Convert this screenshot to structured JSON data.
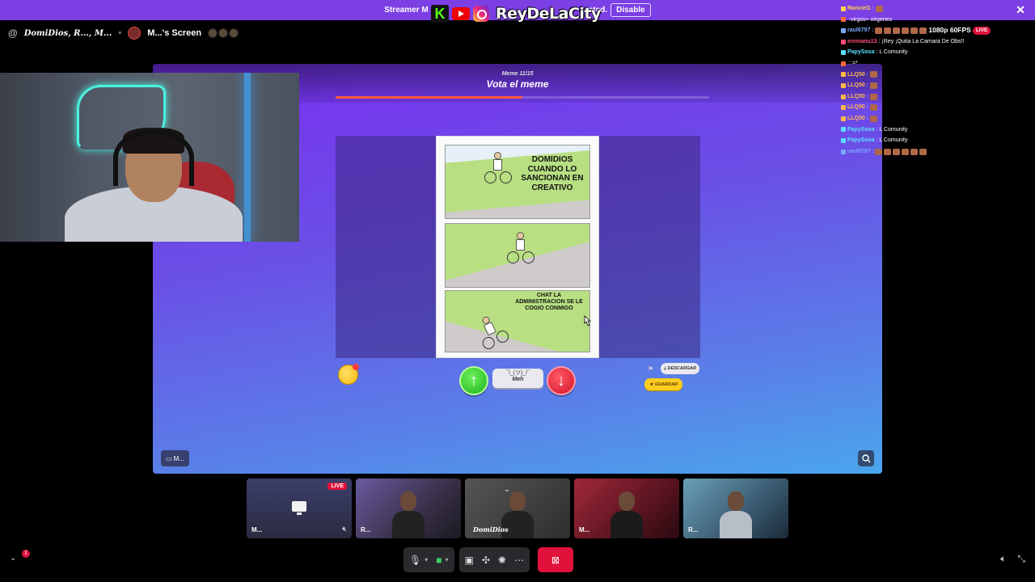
{
  "banner": {
    "text": "Streamer M",
    "text_suffix": "cted.",
    "disable_label": "Disable",
    "close_icon": "close-icon"
  },
  "overlay": {
    "streamer_name": "ReyDeLaCity",
    "icons": [
      "kick-logo",
      "youtube-logo",
      "instagram-logo"
    ]
  },
  "call": {
    "title": "DomiDios, R..., M...",
    "screen_share_label": "M...'s Screen"
  },
  "game": {
    "round_label": "Meme 11/15",
    "heading": "Vota el meme",
    "progress": 0.5,
    "meme": {
      "caption_top": "DOMIDIOS CUANDO LO SANCIONAN EN CREATIVO",
      "caption_bottom": "CHAT LA ADMINISTRACION SE LE COGIO CONMIGO"
    },
    "vote_meh_face": "¯\\_(ツ)_/¯",
    "vote_meh_label": "Meh",
    "download_label": "DESCARGAR",
    "save_label": "GUARDAR",
    "share_badge": "M..."
  },
  "chat": [
    {
      "user": "Ranciel1",
      "text": ":",
      "color": "#ffd24a",
      "emotes": 1
    },
    {
      "user": "",
      "text": ":virgos+ virgenes",
      "color": "#ff6a3c",
      "emotes": 0
    },
    {
      "user": "raul6797",
      "text": ":",
      "color": "#7aa8ff",
      "emotes": 6,
      "fps": "1080p 60FPS",
      "live": "LIVE"
    },
    {
      "user": "emmanu13",
      "text": ": ¡Rey ¡Quita La Camara De Obs!!",
      "color": "#ff4a7a",
      "emotes": 0
    },
    {
      "user": "PapySosa",
      "text": ": L Comunity",
      "color": "#5ae0ff",
      "emotes": 0
    },
    {
      "user": "",
      "text": ": =*",
      "color": "#ff6a3c",
      "emotes": 0
    },
    {
      "user": "LLQ50",
      "text": ":",
      "color": "#ffb84a",
      "emotes": 1
    },
    {
      "user": "LLQ50",
      "text": ":",
      "color": "#ffb84a",
      "emotes": 1
    },
    {
      "user": "LLQ50",
      "text": ":",
      "color": "#ffb84a",
      "emotes": 1
    },
    {
      "user": "LLQ50",
      "text": ":",
      "color": "#ffb84a",
      "emotes": 1
    },
    {
      "user": "LLQ50",
      "text": ":",
      "color": "#ffb84a",
      "emotes": 1
    },
    {
      "user": "PapySosa",
      "text": ": L Comunity",
      "color": "#5ae0ff",
      "emotes": 0
    },
    {
      "user": "PapySosa",
      "text": ": L Comunity",
      "color": "#5ae0ff",
      "emotes": 0
    },
    {
      "user": "raul6797",
      "text": ":",
      "color": "#7aa8ff",
      "emotes": 6
    }
  ],
  "tiles": [
    {
      "label": "M...",
      "live": "LIVE",
      "type": "screen"
    },
    {
      "label": "R...",
      "live": "",
      "type": "cam"
    },
    {
      "label": "DomiDios",
      "live": "",
      "type": "cam"
    },
    {
      "label": "M...",
      "live": "",
      "type": "cam"
    },
    {
      "label": "R...",
      "live": "",
      "type": "cam"
    }
  ],
  "notifications_count": "1",
  "colors": {
    "accent": "#7b3fe4",
    "live": "#e0123b",
    "vote_up": "#1fb31c",
    "vote_down": "#d4142a",
    "save": "#ffcc1f"
  }
}
